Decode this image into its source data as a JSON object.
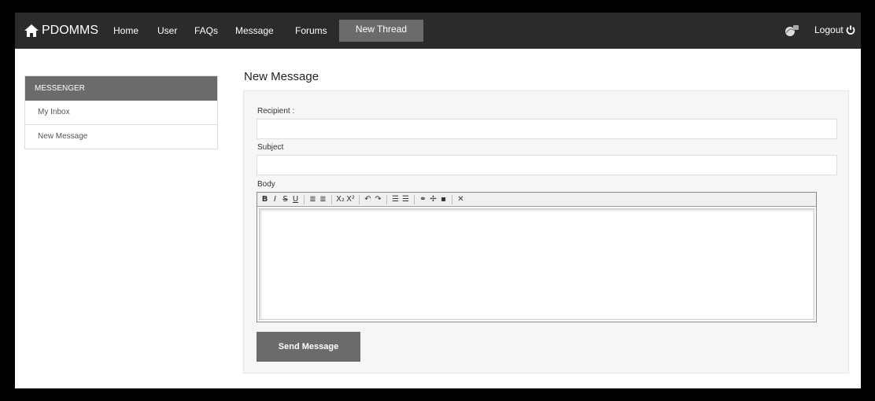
{
  "navbar": {
    "brand": "PDOMMS",
    "links": [
      "Home",
      "User",
      "FAQs",
      "Message",
      "Forums"
    ],
    "active": "New Thread",
    "logout": "Logout"
  },
  "sidebar": {
    "heading": "MESSENGER",
    "items": [
      "My Inbox",
      "New Message"
    ]
  },
  "main": {
    "title": "New Message",
    "recipient_label": "Recipient :",
    "recipient_value": "",
    "subject_label": "Subject",
    "subject_value": "",
    "body_label": "Body",
    "body_value": "",
    "send_label": "Send Message"
  },
  "editor_toolbar": {
    "groups": [
      [
        "B",
        "I",
        "S",
        "U"
      ],
      [
        "≣",
        "≣"
      ],
      [
        "X₂",
        "X²"
      ],
      [
        "↶",
        "↷"
      ],
      [
        "☰",
        "☰"
      ],
      [
        "⚭",
        "✢",
        "▪"
      ],
      [
        "✕"
      ]
    ]
  },
  "colors": {
    "navbar": "#2b2b2b",
    "accent": "#6b6b6b",
    "panel": "#f6f6f6"
  }
}
